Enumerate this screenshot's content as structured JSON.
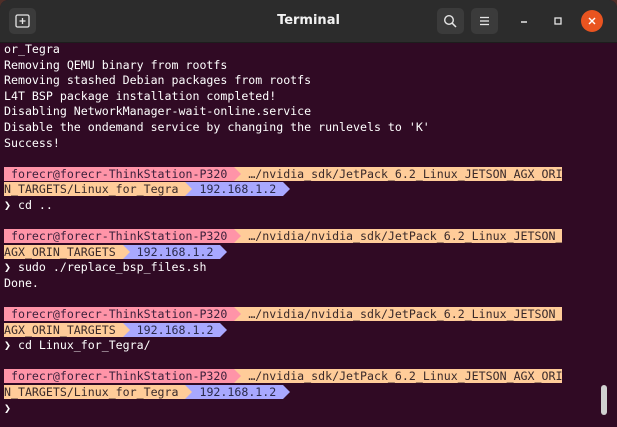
{
  "window": {
    "title": "Terminal"
  },
  "colors": {
    "user_segment": "#ff94a8",
    "path_segment": "#ffcc99",
    "ip_segment": "#a8a8ff",
    "terminal_bg": "#300a24",
    "close_button": "#e95420"
  },
  "icons": {
    "new_tab": "new-tab-icon",
    "search": "search-icon",
    "menu": "hamburger-menu-icon",
    "minimize": "minimize-icon",
    "maximize": "maximize-icon",
    "close": "close-icon"
  },
  "output": [
    "or_Tegra",
    "Removing QEMU binary from rootfs",
    "Removing stashed Debian packages from rootfs",
    "L4T BSP package installation completed!",
    "Disabling NetworkManager-wait-online.service",
    "Disable the ondemand service by changing the runlevels to 'K'",
    "Success!"
  ],
  "prompts": [
    {
      "user": " forecr@forecr-ThinkStation-P320 ",
      "path_line1": " …/nvidia_sdk/JetPack_6.2_Linux_JETSON_AGX_ORI",
      "path_line2": "N_TARGETS/Linux_for_Tegra ",
      "ip": " 192.168.1.2 ",
      "symbol": "❯",
      "command": " cd ..",
      "output": []
    },
    {
      "user": " forecr@forecr-ThinkStation-P320 ",
      "path_line1": " …/nvidia/nvidia_sdk/JetPack_6.2_Linux_JETSON_",
      "path_line2": "AGX_ORIN_TARGETS ",
      "ip": " 192.168.1.2 ",
      "symbol": "❯",
      "command": " sudo ./replace_bsp_files.sh",
      "output": [
        "Done."
      ]
    },
    {
      "user": " forecr@forecr-ThinkStation-P320 ",
      "path_line1": " …/nvidia/nvidia_sdk/JetPack_6.2_Linux_JETSON_",
      "path_line2": "AGX_ORIN_TARGETS ",
      "ip": " 192.168.1.2 ",
      "symbol": "❯",
      "command": " cd Linux_for_Tegra/",
      "output": []
    },
    {
      "user": " forecr@forecr-ThinkStation-P320 ",
      "path_line1": " …/nvidia_sdk/JetPack_6.2_Linux_JETSON_AGX_ORI",
      "path_line2": "N_TARGETS/Linux_for_Tegra ",
      "ip": " 192.168.1.2 ",
      "symbol": "❯",
      "command": "",
      "output": []
    }
  ]
}
